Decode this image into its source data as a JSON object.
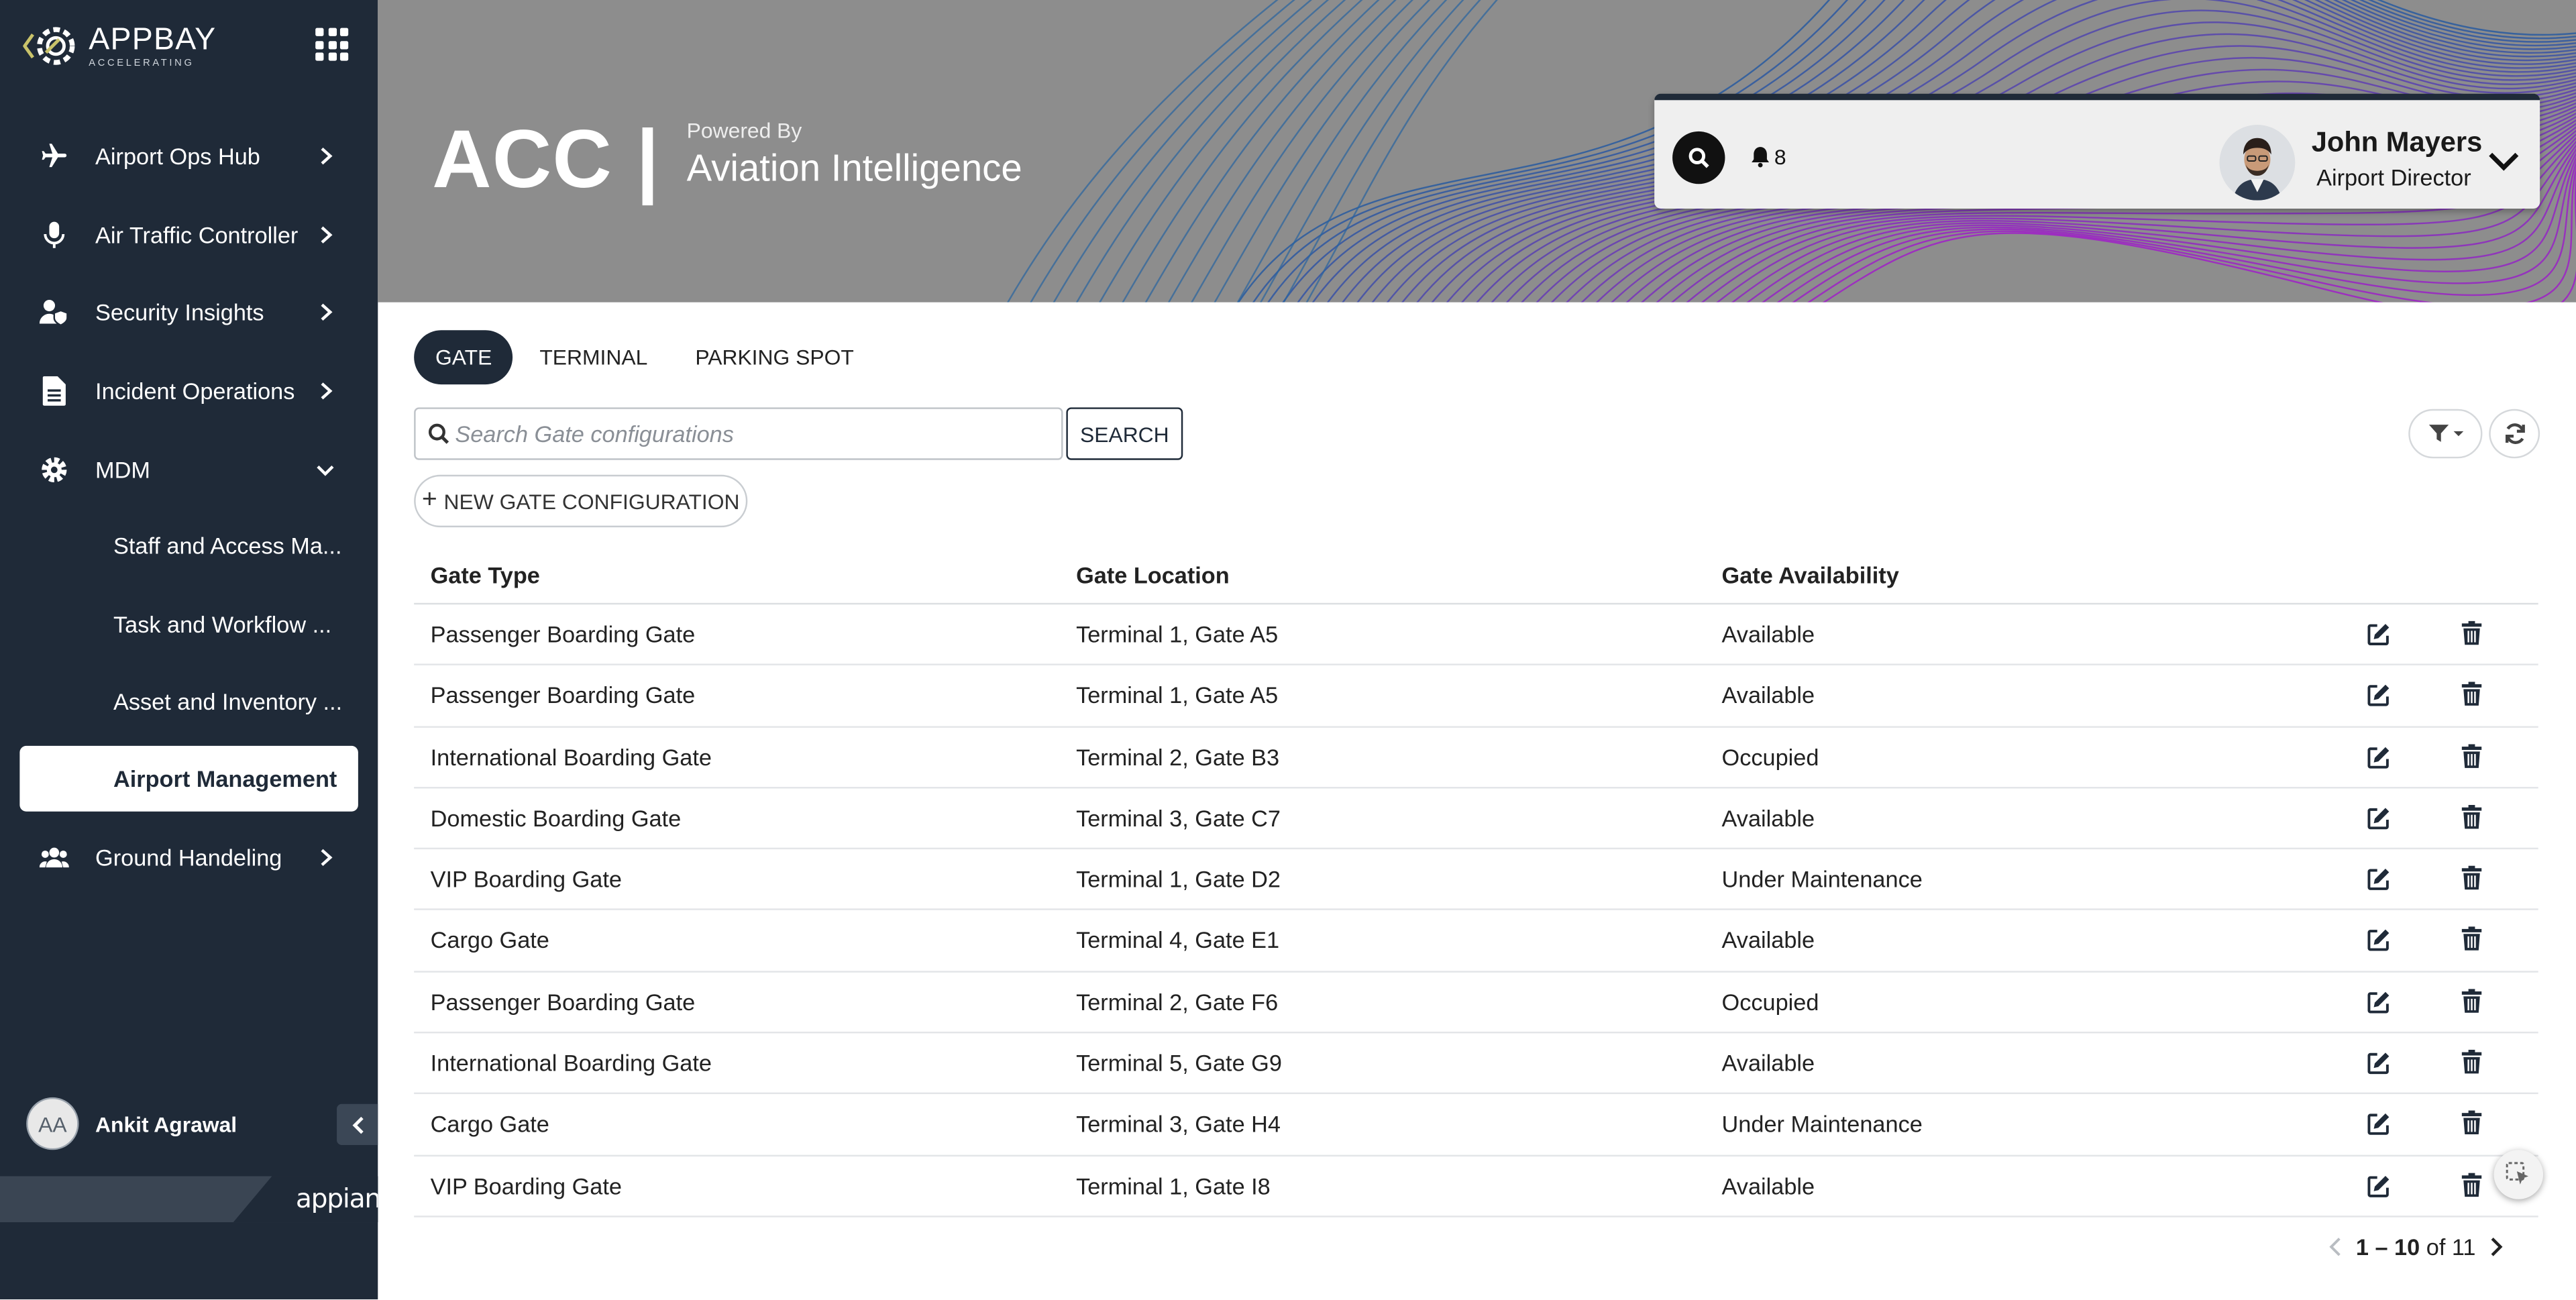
{
  "brand": {
    "logo_title": "APPBAY",
    "logo_tagline": "ACCELERATING",
    "apps_icon": "grid-icon"
  },
  "sidebar": {
    "items": [
      {
        "label": "Airport Ops Hub",
        "icon": "airplane-icon"
      },
      {
        "label": "Air Traffic Controller",
        "icon": "microphone-icon"
      },
      {
        "label": "Security Insights",
        "icon": "user-shield-icon"
      },
      {
        "label": "Incident Operations",
        "icon": "document-icon"
      },
      {
        "label": "MDM",
        "icon": "gear-icon",
        "expanded": true
      }
    ],
    "sub_items": [
      {
        "label": "Staff and Access Ma..."
      },
      {
        "label": "Task and Workflow ..."
      },
      {
        "label": "Asset and Inventory ..."
      },
      {
        "label": "Airport Management",
        "active": true
      }
    ],
    "last_item": {
      "label": "Ground Handeling",
      "icon": "users-icon"
    },
    "user": {
      "initials": "AA",
      "name": "Ankit Agrawal"
    },
    "footer_brand": "appian"
  },
  "header": {
    "title": "ACC |",
    "powered_by": "Powered By",
    "subtitle": "Aviation Intelligence",
    "notification_count": "8",
    "user_name": "John Mayers",
    "user_role": "Airport Director"
  },
  "tabs": [
    {
      "label": "GATE",
      "active": true
    },
    {
      "label": "TERMINAL",
      "active": false
    },
    {
      "label": "PARKING SPOT",
      "active": false
    }
  ],
  "search": {
    "placeholder": "Search Gate configurations",
    "value": "",
    "button_label": "SEARCH"
  },
  "new_button_label": "NEW GATE CONFIGURATION",
  "table": {
    "columns": [
      "Gate Type",
      "Gate Location",
      "Gate Availability"
    ],
    "rows": [
      [
        "Passenger Boarding Gate",
        "Terminal 1, Gate A5",
        "Available"
      ],
      [
        "Passenger Boarding Gate",
        "Terminal 1, Gate A5",
        "Available"
      ],
      [
        "International Boarding Gate",
        "Terminal 2, Gate B3",
        "Occupied"
      ],
      [
        "Domestic Boarding Gate",
        "Terminal 3, Gate C7",
        "Available"
      ],
      [
        "VIP Boarding Gate",
        "Terminal 1, Gate D2",
        "Under Maintenance"
      ],
      [
        "Cargo Gate",
        "Terminal 4, Gate E1",
        "Available"
      ],
      [
        "Passenger Boarding Gate",
        "Terminal 2, Gate F6",
        "Occupied"
      ],
      [
        "International Boarding Gate",
        "Terminal 5, Gate G9",
        "Available"
      ],
      [
        "Cargo Gate",
        "Terminal 3, Gate H4",
        "Under Maintenance"
      ],
      [
        "VIP Boarding Gate",
        "Terminal 1, Gate I8",
        "Available"
      ]
    ]
  },
  "pagination": {
    "range": "1 – 10",
    "of_text": "of 11"
  },
  "colors": {
    "sidebar_bg": "#1f2a38",
    "banner_bg": "#8d8d8d",
    "accent": "#1f2a38"
  }
}
